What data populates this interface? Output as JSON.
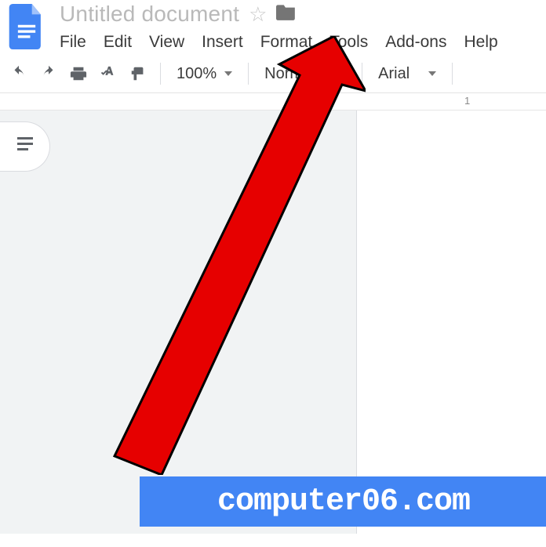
{
  "doc": {
    "title": "Untitled document"
  },
  "menu": {
    "file": "File",
    "edit": "Edit",
    "view": "View",
    "insert": "Insert",
    "format": "Format",
    "tools": "Tools",
    "addons": "Add-ons",
    "help": "Help"
  },
  "toolbar": {
    "zoom": "100%",
    "style": "Normal",
    "font": "Arial"
  },
  "ruler": {
    "one": "1"
  },
  "watermark": "computer06.com"
}
